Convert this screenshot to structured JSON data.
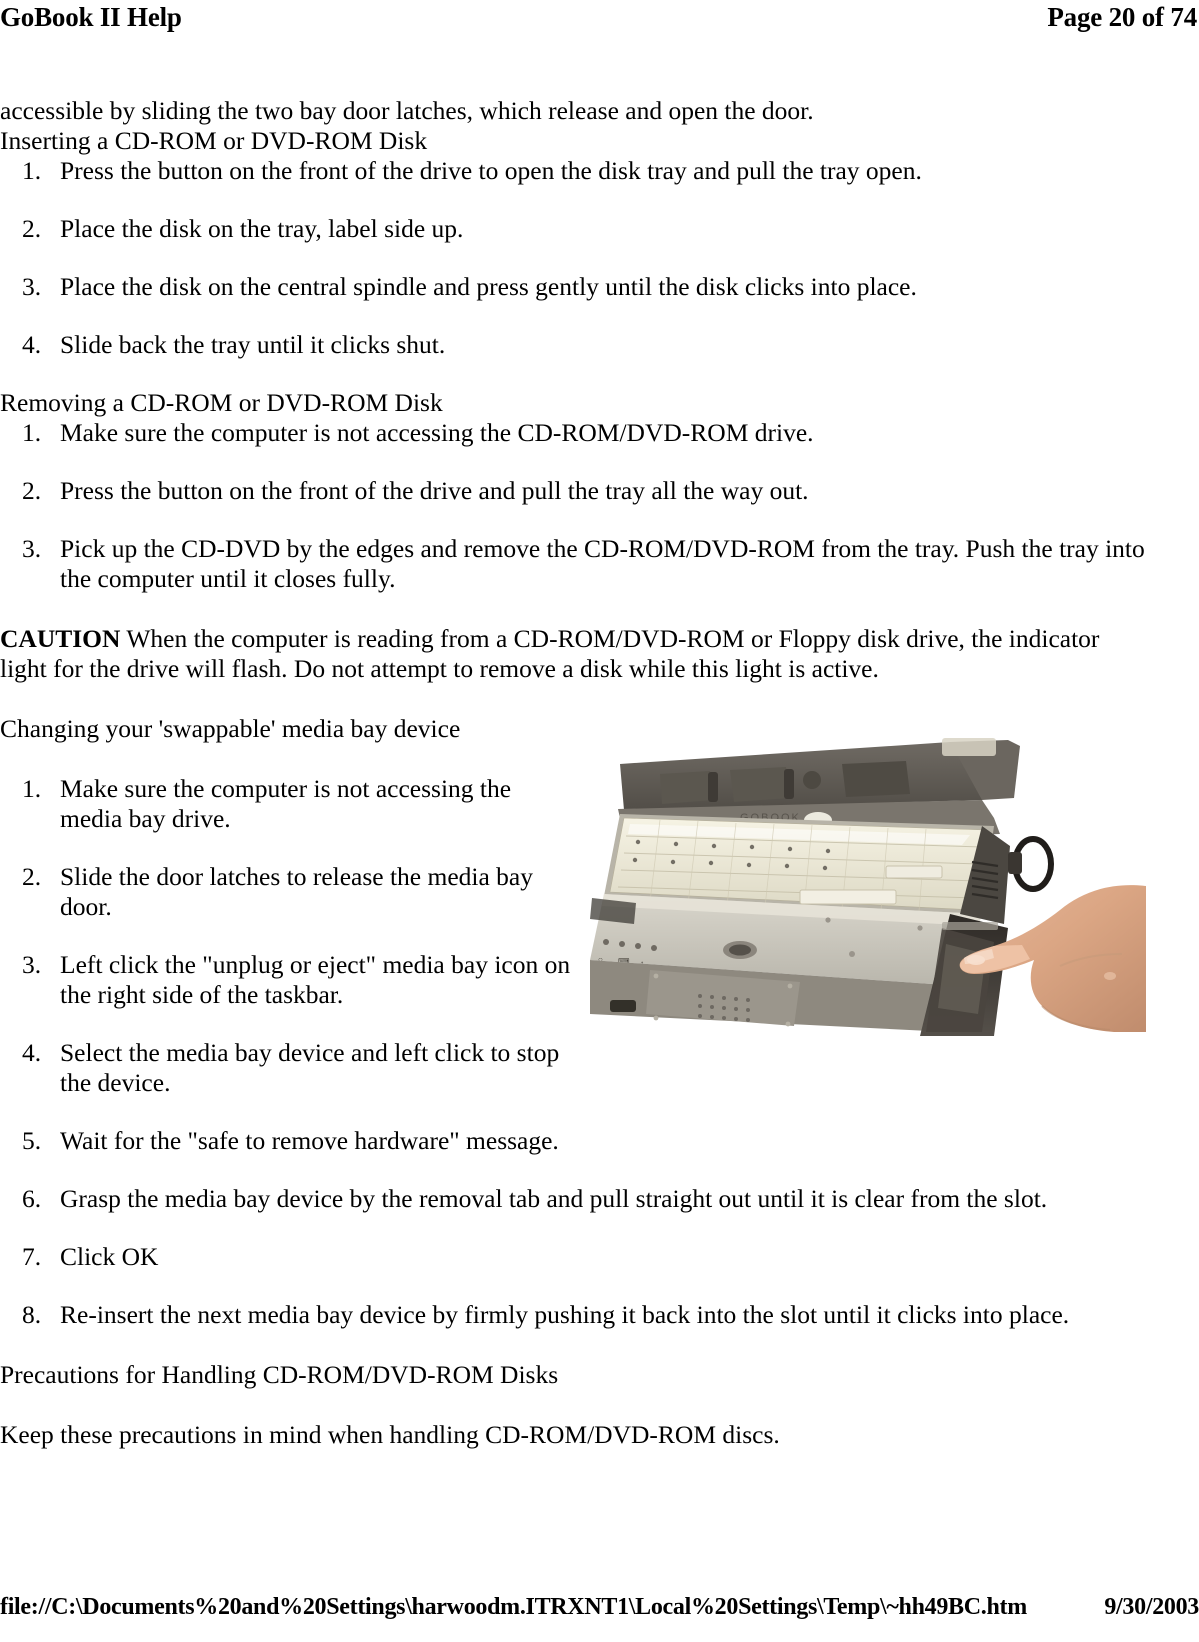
{
  "header": {
    "title": "GoBook II Help",
    "page_label": "Page 20 of 74"
  },
  "footer": {
    "file_path": "file://C:\\Documents%20and%20Settings\\harwoodm.ITRXNT1\\Local%20Settings\\Temp\\~hh49BC.htm",
    "date": "9/30/2003"
  },
  "content": {
    "intro_paragraph": "accessible by sliding the two bay door latches, which  release and open the door.",
    "section_inserting": {
      "heading": "Inserting a CD-ROM or DVD-ROM Disk",
      "steps": [
        "Press the button on the front of the drive to open the disk tray and pull the tray open.",
        "Place the disk on the tray, label side up.",
        "Place the disk on the central spindle and press gently until the disk clicks into place.",
        "Slide back the tray until it clicks shut."
      ]
    },
    "section_removing": {
      "heading": "Removing a CD-ROM or DVD-ROM Disk",
      "steps": [
        "Make sure the computer is not accessing the CD-ROM/DVD-ROM drive.",
        "Press the button on the front of the drive and pull the tray all the way out.",
        "Pick up the CD-DVD by the edges and remove the CD-ROM/DVD-ROM from the tray.  Push the tray into the computer until it closes fully."
      ]
    },
    "caution": {
      "label": "CAUTION",
      "text": " When the computer is reading from a CD-ROM/DVD-ROM or Floppy disk drive, the indicator light for the drive will flash.  Do not attempt to remove a disk while this light is active."
    },
    "section_swappable": {
      "heading": "Changing your 'swappable' media bay device",
      "steps_narrow": [
        "Make sure the computer is not accessing the media bay drive.",
        "Slide the door latches to release the media bay door.",
        "Left click the \"unplug or eject\" media bay icon on the right side of the taskbar.",
        "Select the media bay device and left click to stop the device."
      ],
      "steps_wide": [
        "Wait for the \"safe to remove hardware\" message.",
        "Grasp the media bay device by the removal tab and pull straight out until it is clear from the slot.",
        "Click OK",
        "Re-insert the next media bay device by firmly pushing it back into the slot until it clicks into place."
      ]
    },
    "section_precautions": {
      "heading": "Precautions for Handling CD-ROM/DVD-ROM Disks",
      "paragraph": "Keep these precautions in mind when handling CD-ROM/DVD-ROM discs."
    },
    "figure": {
      "alt": "Photograph of a rugged GoBook II notebook computer, open, with a finger pointing at the swappable media bay on the right side of the chassis"
    }
  }
}
